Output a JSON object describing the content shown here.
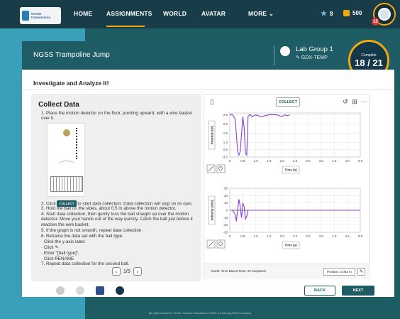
{
  "nav": {
    "logo_text": "Vernier Connections",
    "items": [
      "HOME",
      "ASSIGNMENTS",
      "WORLD",
      "AVATAR",
      "MORE"
    ],
    "more_chevron": "⌄",
    "stars": "8",
    "coins": "500",
    "avatar_level": "15",
    "accent": "#f3a712"
  },
  "assignment": {
    "title": "NGSS Trampoline Jump",
    "lab_group": "Lab Group 1",
    "lab_code": "GDX-TEMP",
    "progress_label": "Complete",
    "progress_value": "18 / 21"
  },
  "card": {
    "title": "Investigate and Analyze It!"
  },
  "collect_panel": {
    "title": "Collect Data",
    "step1": "1. Place the motion detector on the floor, pointing upward, with a wire basket over it.",
    "step2_pre": "2. Click",
    "step2_btn": "COLLECT",
    "step2_post": "to start data collection. Data collection will stop on its own.",
    "step3": "3. Hold the ball on the sides, about 0.5 m above the motion detector.",
    "step4": "4. Start data collection, then gently toss the ball straight up over the motion detector. Move your hands out of the way quickly. Catch the ball just before it reaches the wire basket.",
    "step5": "5. If the graph is not smooth, repeat data collection.",
    "step6": "6. Rename the data set with the ball type.",
    "sub1": "· Click the y-axis label.",
    "sub2": "· Click ✎",
    "sub3": "· Enter \"[ball type]\".",
    "sub4": "· Click RENAME",
    "step7": "7. Repeat data collection for the second ball.",
    "page": "1/5"
  },
  "graph": {
    "collect_label": "COLLECT",
    "status_mode": "Mode: Time Based    Rate: 20 samples/s",
    "status_position": "Position: 2.082 m",
    "x_axis_label": "Time (s)",
    "icons": [
      "file-icon",
      "undo-icon",
      "layout-icon",
      "more-icon",
      "zoom-fit-icon",
      "zoom-icon",
      "tool-icon"
    ]
  },
  "chart_data": [
    {
      "type": "line",
      "ylabel": "Position (m)",
      "xlabel": "Time (s)",
      "xlim": [
        0,
        5.0
      ],
      "ylim": [
        0.2,
        2.6
      ],
      "xticks": [
        "0",
        "0.5",
        "1.0",
        "1.5",
        "2.0",
        "2.5",
        "3.0",
        "3.5",
        "4.0",
        "4.5",
        "5.0"
      ],
      "yticks": [
        "0.2",
        "0.6",
        "1.0",
        "1.5",
        "2.0",
        "2.5"
      ],
      "color": "#8b3fd1",
      "x": [
        0.0,
        0.1,
        0.2,
        0.25,
        0.3,
        0.35,
        0.4,
        0.5,
        0.55,
        0.6,
        0.65,
        0.7,
        0.75,
        0.8,
        0.85,
        1.0,
        1.2,
        1.5,
        1.8,
        2.0,
        2.1,
        2.2,
        2.3
      ],
      "y": [
        2.5,
        2.5,
        2.3,
        1.5,
        0.5,
        0.3,
        0.5,
        2.4,
        1.8,
        0.4,
        0.3,
        2.4,
        2.5,
        2.5,
        2.4,
        2.5,
        2.4,
        2.5,
        2.5,
        2.4,
        2.5,
        2.45,
        2.5
      ]
    },
    {
      "type": "line",
      "ylabel": "Velocity (m/s)",
      "xlabel": "Time (s)",
      "xlim": [
        0,
        5.0
      ],
      "ylim": [
        -30,
        30
      ],
      "xticks": [
        "0",
        "0.5",
        "1.0",
        "1.5",
        "2.0",
        "2.5",
        "3.0",
        "3.5",
        "4.0",
        "4.5",
        "5.0"
      ],
      "yticks": [
        "-30",
        "-20",
        "-10",
        "0",
        "10",
        "20",
        "30"
      ],
      "color": "#8b3fd1",
      "x": [
        0.0,
        0.1,
        0.2,
        0.25,
        0.3,
        0.35,
        0.4,
        0.45,
        0.5,
        0.55,
        0.6,
        0.65,
        0.7,
        0.8,
        1.0,
        1.5,
        2.0,
        2.5,
        3.0,
        3.5,
        4.0,
        4.5,
        5.0
      ],
      "y": [
        0,
        0,
        -5,
        -15,
        0,
        15,
        5,
        -10,
        10,
        5,
        -12,
        -8,
        0,
        0,
        0,
        0,
        0,
        0,
        0,
        0,
        0,
        0,
        0
      ]
    }
  ],
  "footer": {
    "back_label": "BACK",
    "next_label": "NEXT",
    "copyright": "All rights reserved. Vernier Science Education © 2020, a Learning 2024 Company"
  }
}
